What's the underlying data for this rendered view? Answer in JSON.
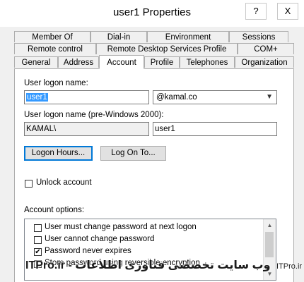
{
  "window": {
    "title": "user1 Properties",
    "help_label": "?",
    "close_label": "X"
  },
  "tabs": {
    "row1": [
      "Member Of",
      "Dial-in",
      "Environment",
      "Sessions"
    ],
    "row2": [
      "Remote control",
      "Remote Desktop Services Profile",
      "COM+"
    ],
    "row3": [
      "General",
      "Address",
      "Account",
      "Profile",
      "Telephones",
      "Organization"
    ],
    "active": "Account"
  },
  "account": {
    "logon_name_label": "User logon name:",
    "logon_name_value": "user1",
    "domain_value": "@kamal.co",
    "pre2000_label": "User logon name (pre-Windows 2000):",
    "pre2000_domain": "KAMAL\\",
    "pre2000_user": "user1",
    "logon_hours_label": "Logon Hours...",
    "log_on_to_label": "Log On To...",
    "unlock_label": "Unlock account",
    "options_label": "Account options:",
    "options": [
      {
        "label": "User must change password at next logon",
        "checked": false
      },
      {
        "label": "User cannot change password",
        "checked": false
      },
      {
        "label": "Password never expires",
        "checked": true
      },
      {
        "label": "Store password using reversible encryption",
        "checked": false
      }
    ]
  },
  "watermark": {
    "text": "ITPro.ir - وب سایت تخصصی فناوری اطلاعات",
    "small": "ITPro.ir"
  }
}
